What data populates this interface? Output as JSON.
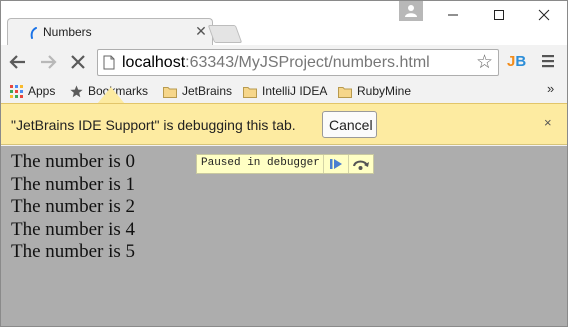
{
  "tab": {
    "title": "Numbers",
    "close_icon": "close-icon"
  },
  "toolbar": {
    "url_host": "localhost",
    "url_rest": ":63343/MyJSProject/numbers.html",
    "extension_j": "J",
    "extension_b": "B"
  },
  "bookmarks": {
    "apps": "Apps",
    "bookmarks": "Bookmarks",
    "items": [
      "JetBrains",
      "IntelliJ IDEA",
      "RubyMine"
    ],
    "more": "»"
  },
  "infobar": {
    "message": "\"JetBrains IDE Support\" is debugging this tab.",
    "cancel_label": "Cancel",
    "close": "×"
  },
  "page": {
    "lines": [
      "The number is 0",
      "The number is 1",
      "The number is 2",
      "The number is 4",
      "The number is 5"
    ],
    "debugger_label": "Paused in debugger"
  },
  "colors": {
    "infobar_bg": "#fdeba1",
    "content_bg": "#adadad",
    "debug_pill_bg": "#ffffc4",
    "jetbrains_orange": "#f28c1b",
    "jetbrains_blue": "#2d8ed8"
  }
}
